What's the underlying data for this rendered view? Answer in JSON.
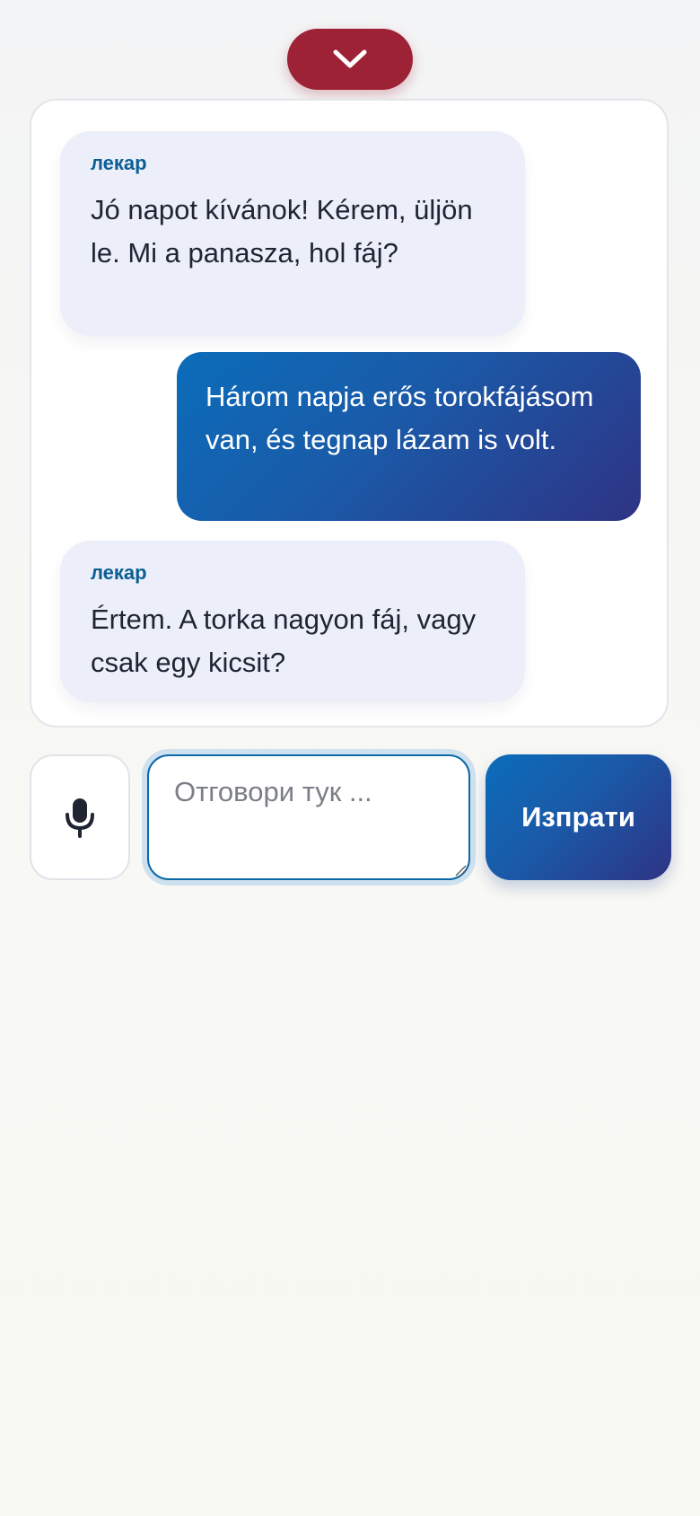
{
  "header": {
    "collapse_icon": "chevron-down-icon",
    "collapse_color": "#9e2235"
  },
  "chat": {
    "messages": [
      {
        "role": "doctor",
        "sender": "лекар",
        "text": "Jó napot kívánok! Kérem, üljön le. Mi a panasza, hol fáj?"
      },
      {
        "role": "user",
        "text": "Három napja erős torokfájásom van, és tegnap lázam is volt."
      },
      {
        "role": "doctor",
        "sender": "лекар",
        "text": "Értem. A torka nagyon fáj, vagy csak egy kicsit?"
      }
    ]
  },
  "composer": {
    "mic_icon": "microphone-icon",
    "placeholder": "Отговори тук ...",
    "value": "",
    "send_label": "Изпрати"
  },
  "colors": {
    "accent_red": "#9e2235",
    "accent_blue": "#0b6dba",
    "accent_indigo": "#2f3384",
    "sender_label": "#0b5e93",
    "doctor_bubble": "#eceff9"
  }
}
